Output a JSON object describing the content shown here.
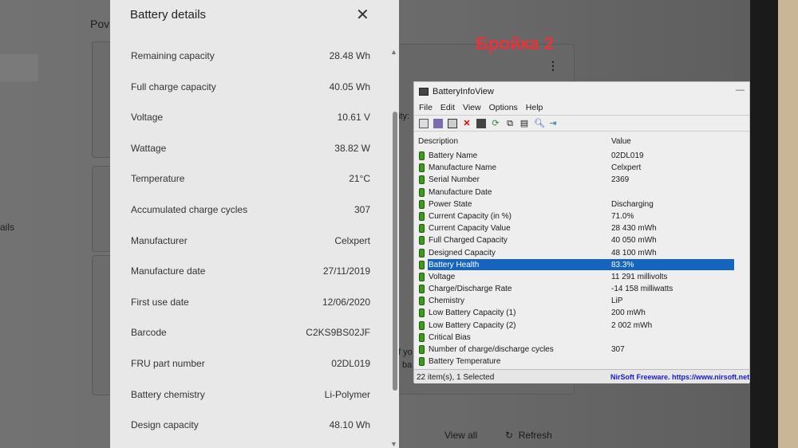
{
  "background": {
    "title_fragment": "Pov",
    "side_fragment": "ails",
    "dots": "⋮",
    "watermark": "Бройка 2",
    "view_all": "View all",
    "refresh": "Refresh",
    "refresh_icon": "↻",
    "card_fragment_1": "ity:",
    "card_fragment_2": "f yo",
    "card_fragment_3": "ba"
  },
  "panel": {
    "title": "Battery details",
    "close_icon": "✕",
    "rows": [
      {
        "label": "Remaining capacity",
        "value": "28.48 Wh"
      },
      {
        "label": "Full charge capacity",
        "value": "40.05 Wh"
      },
      {
        "label": "Voltage",
        "value": "10.61 V"
      },
      {
        "label": "Wattage",
        "value": "38.82 W"
      },
      {
        "label": "Temperature",
        "value": "21°C"
      },
      {
        "label": "Accumulated charge cycles",
        "value": "307"
      },
      {
        "label": "Manufacturer",
        "value": "Celxpert"
      },
      {
        "label": "Manufacture date",
        "value": "27/11/2019"
      },
      {
        "label": "First use date",
        "value": "12/06/2020"
      },
      {
        "label": "Barcode",
        "value": "C2KS9BS02JF"
      },
      {
        "label": "FRU part number",
        "value": "02DL019"
      },
      {
        "label": "Battery chemistry",
        "value": "Li-Polymer"
      },
      {
        "label": "Design capacity",
        "value": "48.10 Wh"
      }
    ]
  },
  "biv": {
    "title": "BatteryInfoView",
    "menu": [
      "File",
      "Edit",
      "View",
      "Options",
      "Help"
    ],
    "col_description": "Description",
    "col_value": "Value",
    "rows": [
      {
        "d": "Battery Name",
        "v": "02DL019"
      },
      {
        "d": "Manufacture Name",
        "v": "Celxpert"
      },
      {
        "d": "Serial Number",
        "v": "2369"
      },
      {
        "d": "Manufacture Date",
        "v": ""
      },
      {
        "d": "Power State",
        "v": "Discharging"
      },
      {
        "d": "Current Capacity (in %)",
        "v": "71.0%"
      },
      {
        "d": "Current Capacity Value",
        "v": "28 430 mWh"
      },
      {
        "d": "Full Charged Capacity",
        "v": "40 050 mWh"
      },
      {
        "d": "Designed Capacity",
        "v": "48 100 mWh"
      },
      {
        "d": "Battery Health",
        "v": "83.3%"
      },
      {
        "d": "Voltage",
        "v": "11 291 millivolts"
      },
      {
        "d": "Charge/Discharge Rate",
        "v": "-14 158 milliwatts"
      },
      {
        "d": "Chemistry",
        "v": "LiP"
      },
      {
        "d": "Low Battery Capacity (1)",
        "v": "200 mWh"
      },
      {
        "d": "Low Battery Capacity (2)",
        "v": "2 002 mWh"
      },
      {
        "d": "Critical Bias",
        "v": ""
      },
      {
        "d": "Number of charge/discharge cycles",
        "v": "307"
      },
      {
        "d": "Battery Temperature",
        "v": ""
      }
    ],
    "selected_index": 9,
    "status_left": "22 item(s), 1 Selected",
    "status_right": "NirSoft Freeware. https://www.nirsoft.net"
  }
}
